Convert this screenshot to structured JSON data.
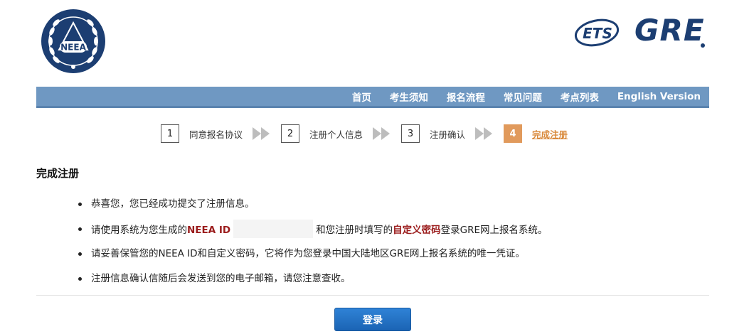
{
  "header": {
    "neea_logo_text": "NEEA",
    "ets_logo_text": "ETS",
    "gre_logo_text": "GRE"
  },
  "nav": {
    "items": [
      {
        "label": "首页"
      },
      {
        "label": "考生须知"
      },
      {
        "label": "报名流程"
      },
      {
        "label": "常见问题"
      },
      {
        "label": "考点列表"
      },
      {
        "label": "English Version"
      }
    ]
  },
  "steps": [
    {
      "number": "1",
      "label": "同意报名协议",
      "active": false
    },
    {
      "number": "2",
      "label": "注册个人信息",
      "active": false
    },
    {
      "number": "3",
      "label": "注册确认",
      "active": false
    },
    {
      "number": "4",
      "label": "完成注册",
      "active": true
    }
  ],
  "main": {
    "title": "完成注册",
    "bullet1": "恭喜您，您已经成功提交了注册信息。",
    "bullet2_prefix": "请使用系统为您生成的",
    "bullet2_id_label": "NEEA ID",
    "bullet2_middle": "和您注册时填写的",
    "bullet2_pwd_label": "自定义密码",
    "bullet2_suffix": "登录GRE网上报名系统。",
    "bullet3": "请妥善保管您的NEEA ID和自定义密码，它将作为您登录中国大陆地区GRE网上报名系统的唯一凭证。",
    "bullet4": "注册信息确认信随后会发送到您的电子邮箱，请您注意查收。"
  },
  "actions": {
    "login_label": "登录"
  },
  "colors": {
    "navbar": "#6f98c2",
    "active_step": "#e19a5c",
    "highlight": "#9b1c1c",
    "button": "#1b64b4",
    "logo_blue": "#1c3e72"
  }
}
